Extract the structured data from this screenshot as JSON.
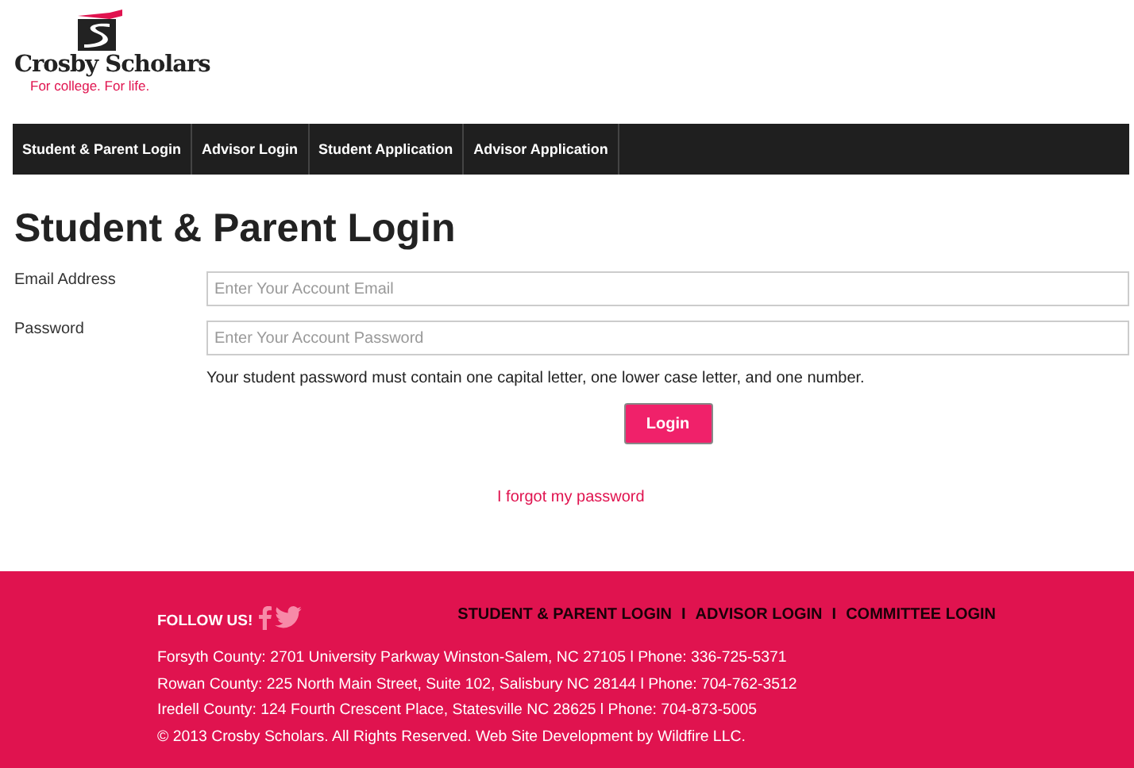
{
  "logo": {
    "name": "Crosby Scholars",
    "tagline": "For college. For life."
  },
  "nav": [
    {
      "label": "Student & Parent Login"
    },
    {
      "label": "Advisor Login"
    },
    {
      "label": "Student Application"
    },
    {
      "label": "Advisor Application"
    }
  ],
  "heading": "Student & Parent Login",
  "fields": [
    {
      "label": "Email Address",
      "placeholder": "Enter Your Account Email"
    },
    {
      "label": "Password",
      "placeholder": "Enter Your Account Password"
    }
  ],
  "hint": "Your student password must contain one capital letter, one lower case letter, and one number.",
  "login_button": "Login",
  "forgot_link": "I forgot my password",
  "footer": {
    "follow": "FOLLOW US!",
    "links": [
      {
        "label": "STUDENT & PARENT LOGIN"
      },
      {
        "label": "ADVISOR LOGIN"
      },
      {
        "label": "COMMITTEE LOGIN"
      }
    ],
    "separators": [
      "I",
      "I"
    ],
    "lines": [
      "Forsyth County: 2701 University Parkway Winston-Salem, NC 27105 l Phone: 336-725-5371",
      "Rowan County: 225 North Main Street, Suite 102, Salisbury NC 28144 l Phone: 704-762-3512",
      "Iredell County: 124 Fourth Crescent Place, Statesville NC 28625 l Phone: 704-873-5005",
      "© 2013 Crosby Scholars. All Rights Reserved. Web Site Development by Wildfire LLC."
    ]
  }
}
